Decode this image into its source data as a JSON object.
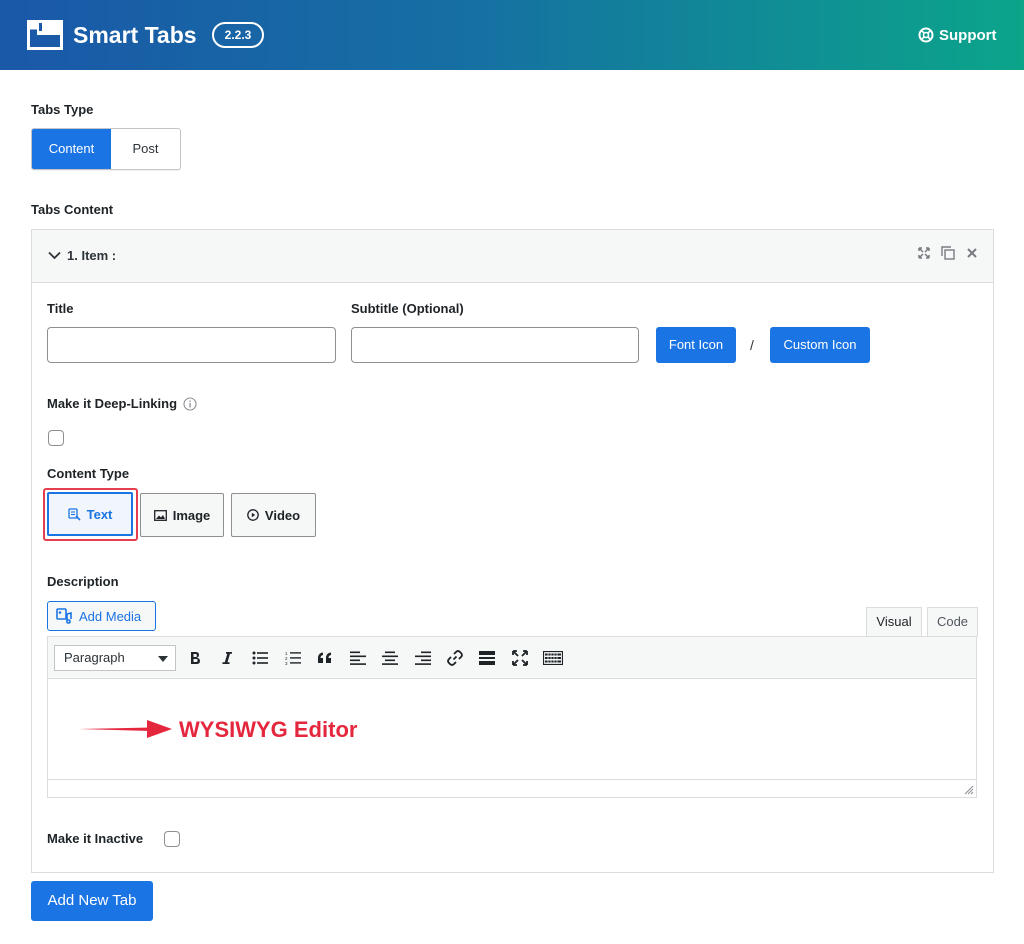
{
  "header": {
    "app_title": "Smart Tabs",
    "version": "2.2.3",
    "support_label": "Support",
    "gradient_start": "#1a58a8",
    "gradient_end": "#0ba58a"
  },
  "tabs_type": {
    "label": "Tabs Type",
    "options": [
      "Content",
      "Post"
    ],
    "selected": "Content"
  },
  "tabs_content": {
    "label": "Tabs Content",
    "item_title": "1. Item :",
    "title_label": "Title",
    "title_value": "",
    "subtitle_label": "Subtitle (Optional)",
    "subtitle_value": "",
    "font_icon_label": "Font Icon",
    "icon_separator": "/",
    "custom_icon_label": "Custom Icon",
    "deep_link_label": "Make it Deep-Linking",
    "deep_link_checked": false,
    "content_type_label": "Content Type",
    "content_types": [
      {
        "label": "Text",
        "icon": "text-icon"
      },
      {
        "label": "Image",
        "icon": "image-icon"
      },
      {
        "label": "Video",
        "icon": "video-icon"
      }
    ],
    "selected_content_type": "Text",
    "description_label": "Description",
    "add_media_label": "Add Media",
    "editor_tabs": [
      "Visual",
      "Code"
    ],
    "editor_active_tab": "Visual",
    "format_select": "Paragraph",
    "annotation": "WYSIWYG Editor",
    "inactive_label": "Make it Inactive",
    "inactive_checked": false
  },
  "add_new_tab_label": "Add New Tab",
  "colors": {
    "accent": "#1b74e4",
    "annotation": "#e5273e"
  }
}
